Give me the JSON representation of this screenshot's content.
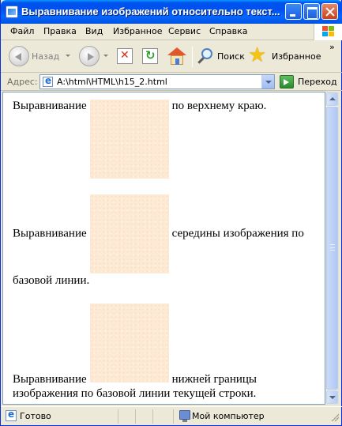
{
  "window": {
    "title": "Выравнивание изображений относительно текст..."
  },
  "menu": {
    "items": [
      "Файл",
      "Правка",
      "Вид",
      "Избранное",
      "Сервис",
      "Справка"
    ]
  },
  "toolbar": {
    "back_label": "Назад",
    "search_label": "Поиск",
    "favorites_label": "Избранное",
    "more_label": "»"
  },
  "address": {
    "label": "Адрес:",
    "value": "A:\\html\\HTML\\h15_2.html",
    "go_label": "Переход"
  },
  "content": {
    "p1_before": "Выравнивание",
    "p1_after": "по верхнему краю.",
    "p2_before": "Выравнивание",
    "p2_after": "середины изображения по базовой линии.",
    "p3_before": "Выравнивание",
    "p3_after": "нижней границы изображения по базовой линии текущей строки."
  },
  "statusbar": {
    "status": "Готово",
    "zone": "Мой компьютер"
  },
  "colors": {
    "titlebar": "#0053ee",
    "image_fill": "#fde9d4"
  }
}
